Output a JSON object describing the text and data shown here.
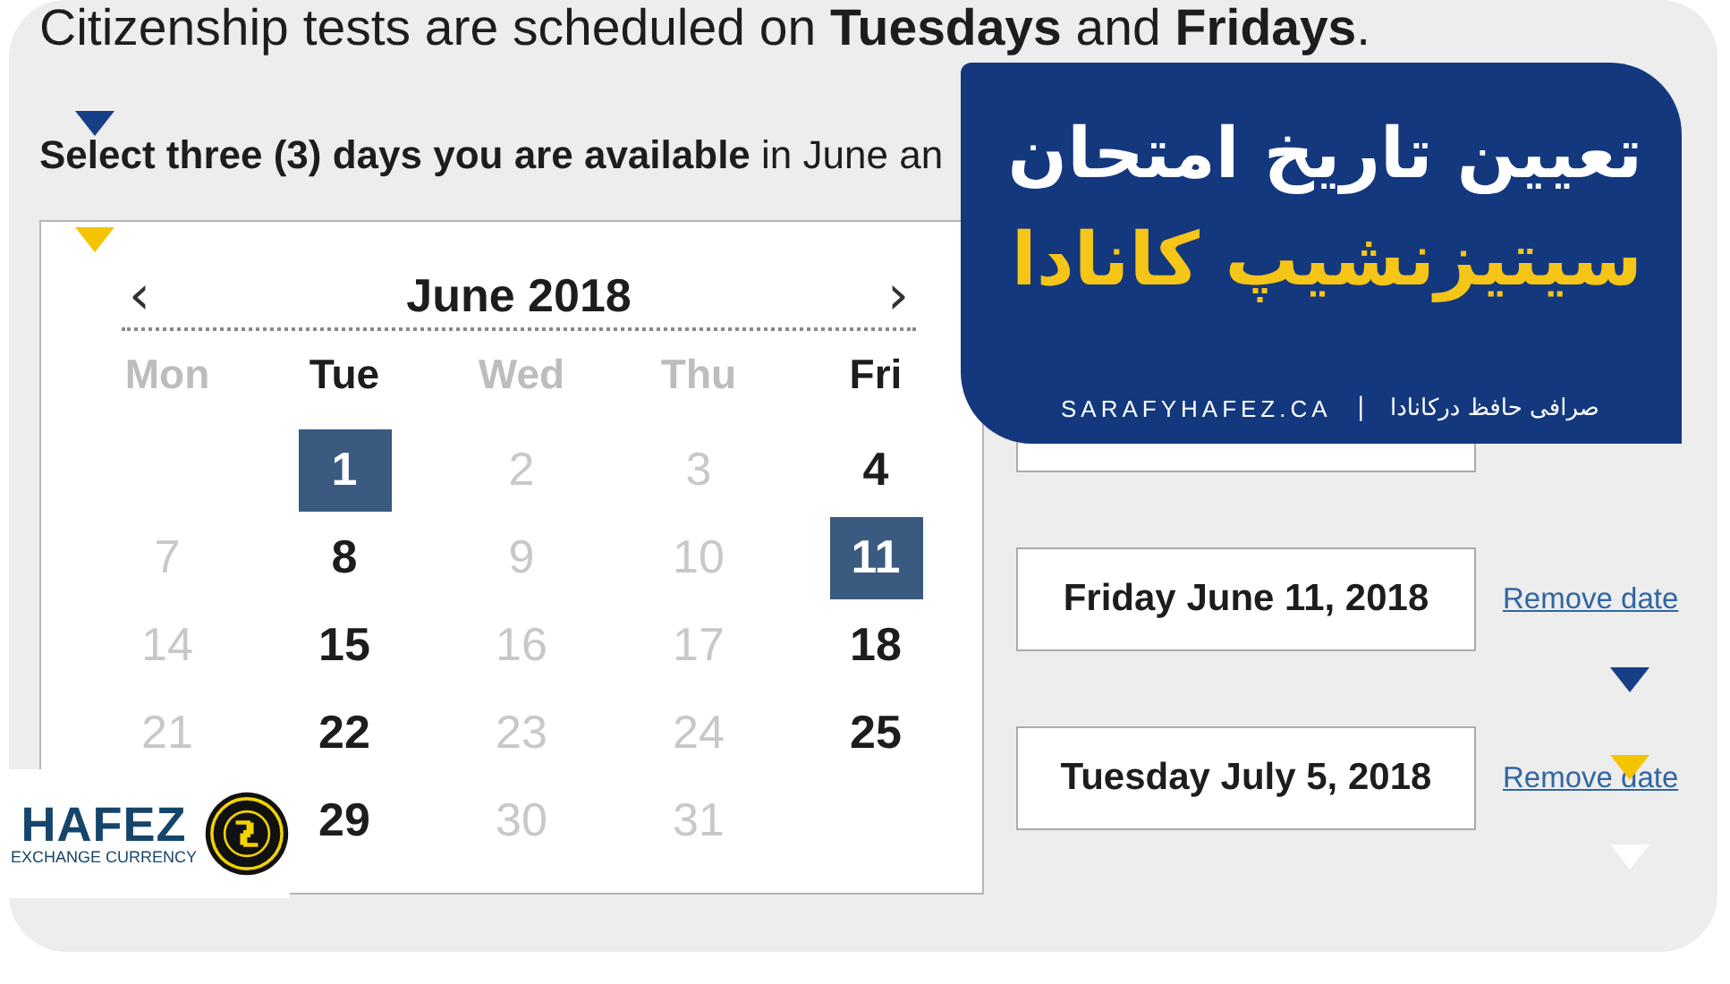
{
  "intro": "Citizenship tests are scheduled on **Tuesdays** and **Fridays**.",
  "instruction": "**Select three (3) days you are available** in June an",
  "calendar": {
    "prev": "‹",
    "month": "June 2018",
    "next": "›",
    "weekdays": [
      {
        "label": "Mon",
        "available": false
      },
      {
        "label": "Tue",
        "available": true
      },
      {
        "label": "Wed",
        "available": false
      },
      {
        "label": "Thu",
        "available": false
      },
      {
        "label": "Fri",
        "available": true
      }
    ],
    "weeks": [
      [
        {
          "kind": "blank"
        },
        {
          "kind": "day",
          "day": "1",
          "available": true,
          "selected": true
        },
        {
          "kind": "day",
          "day": "2",
          "available": false,
          "selected": false
        },
        {
          "kind": "day",
          "day": "3",
          "available": false,
          "selected": false
        },
        {
          "kind": "day",
          "day": "4",
          "available": true,
          "selected": false
        }
      ],
      [
        {
          "kind": "day",
          "day": "7",
          "available": false,
          "selected": false
        },
        {
          "kind": "day",
          "day": "8",
          "available": true,
          "selected": false
        },
        {
          "kind": "day",
          "day": "9",
          "available": false,
          "selected": false
        },
        {
          "kind": "day",
          "day": "10",
          "available": false,
          "selected": false
        },
        {
          "kind": "day",
          "day": "11",
          "available": true,
          "selected": true
        }
      ],
      [
        {
          "kind": "day",
          "day": "14",
          "available": false,
          "selected": false
        },
        {
          "kind": "day",
          "day": "15",
          "available": true,
          "selected": false
        },
        {
          "kind": "day",
          "day": "16",
          "available": false,
          "selected": false
        },
        {
          "kind": "day",
          "day": "17",
          "available": false,
          "selected": false
        },
        {
          "kind": "day",
          "day": "18",
          "available": true,
          "selected": false
        }
      ],
      [
        {
          "kind": "day",
          "day": "21",
          "available": false,
          "selected": false
        },
        {
          "kind": "day",
          "day": "22",
          "available": true,
          "selected": false
        },
        {
          "kind": "day",
          "day": "23",
          "available": false,
          "selected": false
        },
        {
          "kind": "day",
          "day": "24",
          "available": false,
          "selected": false
        },
        {
          "kind": "day",
          "day": "25",
          "available": true,
          "selected": false
        }
      ],
      [
        {
          "kind": "blank"
        },
        {
          "kind": "day",
          "day": "29",
          "available": true,
          "selected": false
        },
        {
          "kind": "day",
          "day": "30",
          "available": false,
          "selected": false
        },
        {
          "kind": "day",
          "day": "31",
          "available": false,
          "selected": false
        },
        {
          "kind": "blank"
        }
      ]
    ]
  },
  "dates_selected": {
    "dates": [
      {
        "date": "Friday June 11, 2018",
        "action": "Remove date"
      },
      {
        "date": "Tuesday July 5, 2018",
        "action": "Remove date"
      }
    ]
  },
  "banner": {
    "title_line_1": "تعیین تاریخ امتحان",
    "title_line_2": "سیتیزنشیپ کانادا",
    "website": "SARAFYHAFEZ.CA",
    "separator": "|",
    "tagline": "صرافی حافظ درکانادا"
  },
  "logo": {
    "name": "HAFEZ",
    "subtitle": "EXCHANGE CURRENCY"
  }
}
